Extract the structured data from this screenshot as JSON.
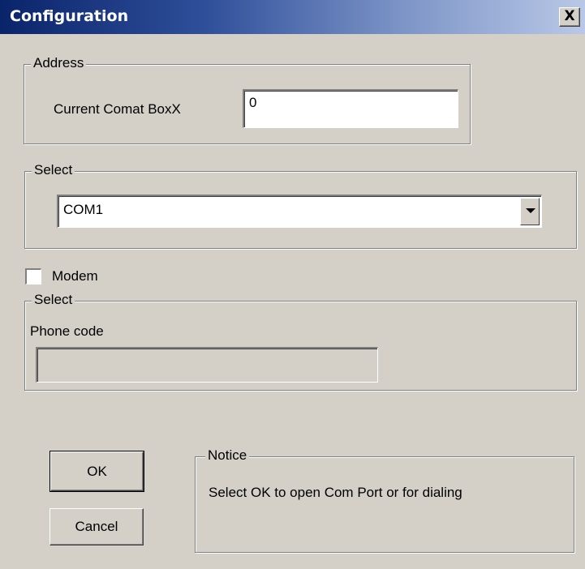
{
  "window": {
    "title": "Configuration",
    "close_label": "X"
  },
  "address": {
    "legend": "Address",
    "label": "Current Comat BoxX",
    "value": "0"
  },
  "port_select": {
    "legend": "Select",
    "selected": "COM1"
  },
  "modem": {
    "label": "Modem",
    "checked": false
  },
  "phone": {
    "legend": "Select",
    "label": "Phone code",
    "value": ""
  },
  "buttons": {
    "ok": "OK",
    "cancel": "Cancel"
  },
  "notice": {
    "legend": "Notice",
    "text": "Select OK to open Com Port or for dialing"
  }
}
